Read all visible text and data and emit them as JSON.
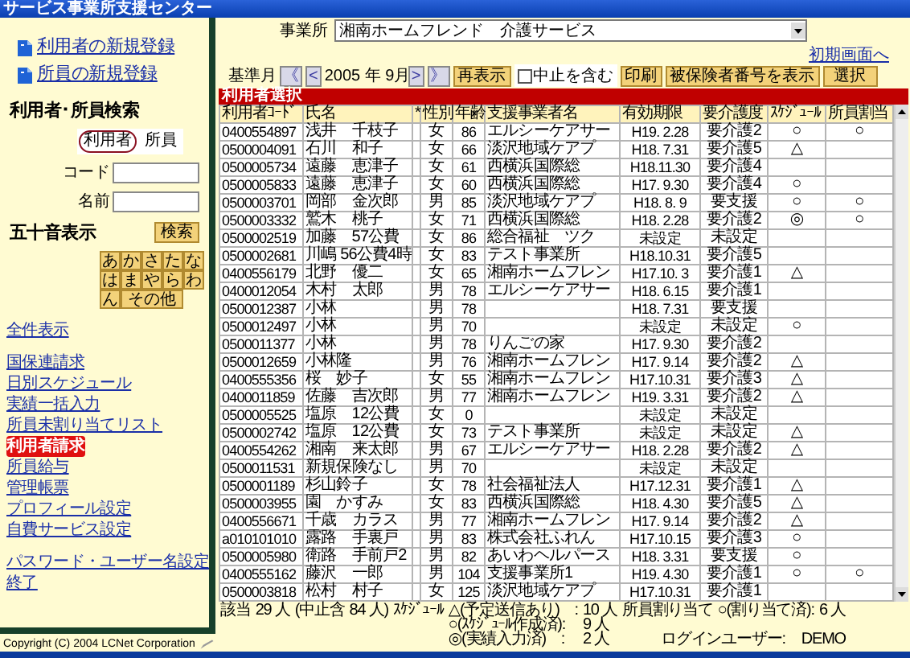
{
  "window": {
    "title": "サービス事業所支援センター"
  },
  "sidebar": {
    "top_links": [
      {
        "label": "利用者の新規登録"
      },
      {
        "label": "所員の新規登録"
      }
    ],
    "search_title": "利用者･所員検索",
    "search_toggle": [
      {
        "label": "利用者",
        "selected": true
      },
      {
        "label": "所員",
        "selected": false
      }
    ],
    "code_label": "コード",
    "name_label": "名前",
    "kana_title": "五十音表示",
    "search_button": "検索",
    "kana": [
      "あ",
      "か",
      "さ",
      "た",
      "な",
      "は",
      "ま",
      "や",
      "ら",
      "わ",
      "ん",
      "その他"
    ],
    "all_link": "全件表示",
    "menu": [
      {
        "label": "国保連請求",
        "selected": false
      },
      {
        "label": "日別スケジュール",
        "selected": false
      },
      {
        "label": "実績一括入力",
        "selected": false
      },
      {
        "label": "所員未割り当てリスト",
        "selected": false
      },
      {
        "label": "利用者請求",
        "selected": true
      },
      {
        "label": "所員給与",
        "selected": false
      },
      {
        "label": "管理帳票",
        "selected": false
      },
      {
        "label": "プロフィール設定",
        "selected": false
      },
      {
        "label": "自費サービス設定",
        "selected": false
      }
    ],
    "bottom_links": [
      {
        "label": "パスワード・ユーザー名設定"
      },
      {
        "label": "終了"
      }
    ],
    "copyright": "Copyright (C) 2004 LCNet Corporation"
  },
  "header": {
    "office_label": "事業所",
    "office_value": "湘南ホームフレンド　介護サービス",
    "initial_link": "初期画面へ",
    "month_label": "基準月",
    "nav": [
      "《",
      "<",
      ">",
      "》"
    ],
    "month": "2005 年 9月",
    "redisplay": "再表示",
    "include_stopped": {
      "label": "中止を含む",
      "checked": false
    },
    "print": "印刷",
    "insured_number": "被保険者番号を表示",
    "select": "選択"
  },
  "table": {
    "title": "利用者選択",
    "columns": [
      "利用者ｺｰﾄﾞ",
      "氏名",
      "*",
      "性別",
      "年齢",
      "支援事業者名",
      "有効期限",
      "要介護度",
      "ｽｹｼﾞｭｰﾙ",
      "所員割当"
    ],
    "rows": [
      {
        "code": "0400554897",
        "name": "浅井　千枝子",
        "sex": "女",
        "age": "86",
        "office": "エルシーケアサー",
        "expiry": "H19. 2.28",
        "care": "要介護2",
        "schedule": "○",
        "staff": "○"
      },
      {
        "code": "0500004091",
        "name": "石川　和子",
        "sex": "女",
        "age": "66",
        "office": "淡沢地域ケアプ",
        "expiry": "H18. 7.31",
        "care": "要介護5",
        "schedule": "△"
      },
      {
        "code": "0500005734",
        "name": "遠藤　恵津子",
        "sex": "女",
        "age": "61",
        "office": "西横浜国際総",
        "expiry": "H18.11.30",
        "care": "要介護4"
      },
      {
        "code": "0500005833",
        "name": "遠藤　恵津子",
        "sex": "女",
        "age": "60",
        "office": "西横浜国際総",
        "expiry": "H17. 9.30",
        "care": "要介護4",
        "schedule": "○"
      },
      {
        "code": "0500003701",
        "name": "岡部　金次郎",
        "sex": "男",
        "age": "85",
        "office": "淡沢地域ケアプ",
        "expiry": "H18. 8. 9",
        "care": "要支援",
        "schedule": "○",
        "staff": "○"
      },
      {
        "code": "0500003332",
        "name": "鷲木　桃子",
        "sex": "女",
        "age": "71",
        "office": "西横浜国際総",
        "expiry": "H18. 2.28",
        "care": "要介護2",
        "schedule": "◎",
        "staff": "○"
      },
      {
        "code": "0500002519",
        "name": "加藤　57公費",
        "sex": "女",
        "age": "86",
        "office": "総合福祉　ツク",
        "expiry": "未設定",
        "care": "未設定"
      },
      {
        "code": "0500002681",
        "name": "川嶋 56公費4時",
        "sex": "女",
        "age": "83",
        "office": "テスト事業所",
        "expiry": "H18.10.31",
        "care": "要介護5"
      },
      {
        "code": "0400556179",
        "name": "北野　優二",
        "sex": "女",
        "age": "65",
        "office": "湘南ホームフレン",
        "expiry": "H17.10. 3",
        "care": "要介護1",
        "schedule": "△"
      },
      {
        "code": "0400012054",
        "name": "木村　太郎",
        "sex": "男",
        "age": "78",
        "office": "エルシーケアサー",
        "expiry": "H18. 6.15",
        "care": "要介護1"
      },
      {
        "code": "0500012387",
        "name": "小林",
        "sex": "男",
        "age": "78",
        "expiry": "H18. 7.31",
        "care": "要支援"
      },
      {
        "code": "0500012497",
        "name": "小林",
        "sex": "男",
        "age": "70",
        "expiry": "未設定",
        "care": "未設定",
        "schedule": "○"
      },
      {
        "code": "0500011377",
        "name": "小林",
        "sex": "男",
        "age": "78",
        "office": "りんごの家",
        "expiry": "H17. 9.30",
        "care": "要介護2"
      },
      {
        "code": "0500012659",
        "name": "小林隆",
        "sex": "男",
        "age": "76",
        "office": "湘南ホームフレン",
        "expiry": "H17. 9.14",
        "care": "要介護2",
        "schedule": "△"
      },
      {
        "code": "0400555356",
        "name": "桜　妙子",
        "sex": "女",
        "age": "55",
        "office": "湘南ホームフレン",
        "expiry": "H17.10.31",
        "care": "要介護3",
        "schedule": "△"
      },
      {
        "code": "0400011859",
        "name": "佐藤　吉次郎",
        "sex": "男",
        "age": "77",
        "office": "湘南ホームフレン",
        "expiry": "H19. 3.31",
        "care": "要介護2",
        "schedule": "△"
      },
      {
        "code": "0500005525",
        "name": "塩原　12公費",
        "sex": "女",
        "age": "0",
        "expiry": "未設定",
        "care": "未設定"
      },
      {
        "code": "0500002742",
        "name": "塩原　12公費",
        "sex": "女",
        "age": "73",
        "office": "テスト事業所",
        "expiry": "未設定",
        "care": "未設定",
        "schedule": "△"
      },
      {
        "code": "0400554262",
        "name": "湘南　来太郎",
        "sex": "男",
        "age": "67",
        "office": "エルシーケアサー",
        "expiry": "H18. 2.28",
        "care": "要介護2",
        "schedule": "△"
      },
      {
        "code": "0500011531",
        "name": "新規保険なし",
        "sex": "男",
        "age": "70",
        "expiry": "未設定",
        "care": "未設定"
      },
      {
        "code": "0500001189",
        "name": "杉山鈴子",
        "sex": "女",
        "age": "78",
        "office": "社会福祉法人",
        "expiry": "H17.12.31",
        "care": "要介護1",
        "schedule": "△"
      },
      {
        "code": "0500003955",
        "name": "園　かすみ",
        "sex": "女",
        "age": "83",
        "office": "西横浜国際総",
        "expiry": "H18. 4.30",
        "care": "要介護5",
        "schedule": "△"
      },
      {
        "code": "0400556671",
        "name": "千歳　カラス",
        "sex": "男",
        "age": "77",
        "office": "湘南ホームフレン",
        "expiry": "H17. 9.14",
        "care": "要介護2",
        "schedule": "△"
      },
      {
        "code": "a010101010",
        "name": "露路　手裏戸",
        "sex": "男",
        "age": "83",
        "office": "株式会社ふれん",
        "expiry": "H17.10.15",
        "care": "要介護3",
        "schedule": "○"
      },
      {
        "code": "0500005980",
        "name": "衛路　手前戸2",
        "sex": "男",
        "age": "82",
        "office": "あいわヘルパース",
        "expiry": "H18. 3.31",
        "care": "要支援",
        "schedule": "○"
      },
      {
        "code": "0400555162",
        "name": "藤沢　一郎",
        "sex": "男",
        "age": "104",
        "office": "支援事業所1",
        "expiry": "H19. 4.30",
        "care": "要介護1",
        "schedule": "○",
        "staff": "○"
      },
      {
        "code": "0500003818",
        "name": "松村　村子",
        "sex": "女",
        "age": "125",
        "office": "淡沢地域ケアプ",
        "expiry": "H17.10.31",
        "care": "要介護1"
      }
    ]
  },
  "summary": {
    "count_label": "該当",
    "count": "29 人",
    "stopped_label": "(中止含",
    "stopped": "84 人)",
    "schedule_label": "ｽｹｼﾞｭｰﾙ",
    "schedule_items": [
      {
        "label": "△(予定送信あり)　:",
        "value": "10 人"
      },
      {
        "label": "○(ｽｹｼﾞｭｰﾙ作成済):",
        "value": "9 人"
      },
      {
        "label": "◎(実績入力済)　:",
        "value": "2 人"
      }
    ],
    "staff_label": "所員割り当て",
    "staff_item": "○(割り当て済):",
    "staff_value": "6 人",
    "login_label": "ログインユーザー:",
    "login_value": "DEMO"
  }
}
